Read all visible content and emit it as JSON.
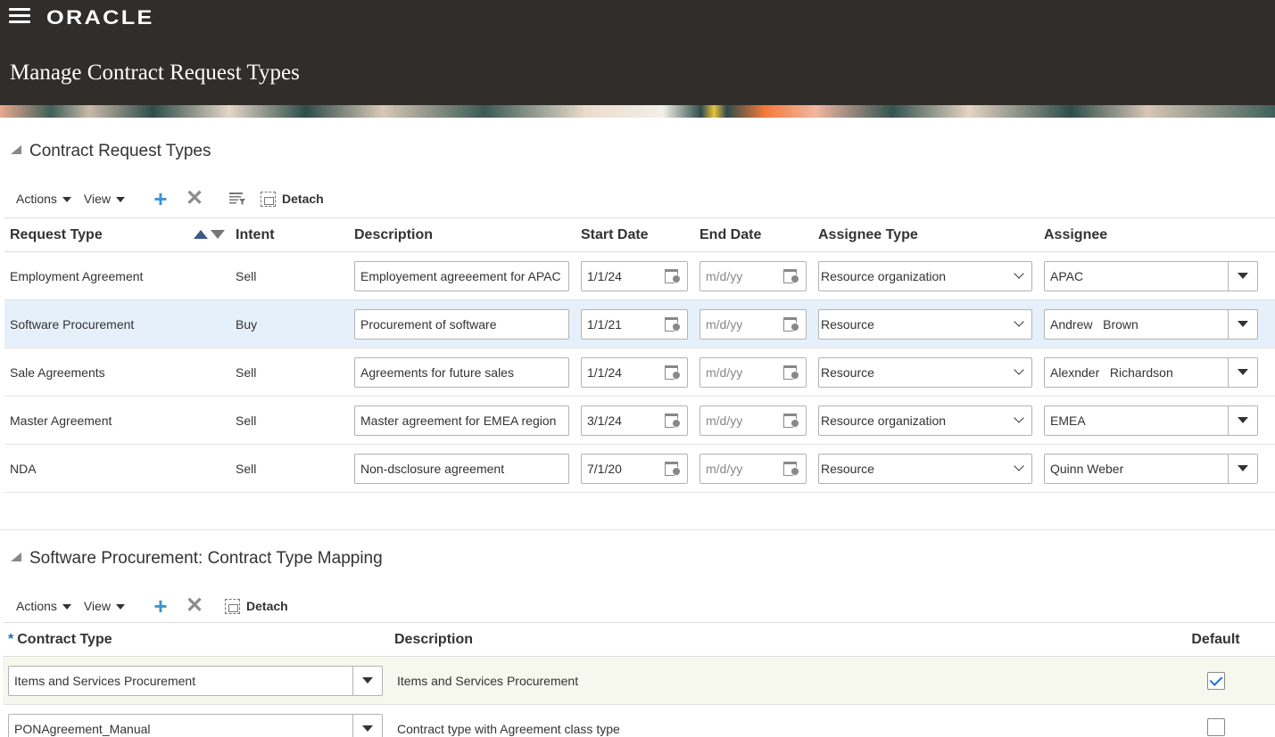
{
  "header": {
    "logo": "ORACLE",
    "title": "Manage Contract Request Types"
  },
  "section1": {
    "title": "Contract Request Types",
    "toolbar": {
      "actions": "Actions",
      "view": "View",
      "detach": "Detach"
    },
    "columns": [
      "Request Type",
      "Intent",
      "Description",
      "Start Date",
      "End Date",
      "Assignee Type",
      "Assignee"
    ],
    "rows": [
      {
        "request_type": "Employment Agreement",
        "intent": "Sell",
        "description": "Employement agreeement for APAC",
        "start_date": "1/1/24",
        "end_date": "m/d/yy",
        "assignee_type": "Resource organization",
        "assignee": "APAC"
      },
      {
        "request_type": "Software Procurement",
        "intent": "Buy",
        "description": "Procurement of software",
        "start_date": "1/1/21",
        "end_date": "m/d/yy",
        "assignee_type": "Resource",
        "assignee": "Andrew   Brown"
      },
      {
        "request_type": "Sale Agreements",
        "intent": "Sell",
        "description": "Agreements for future sales",
        "start_date": "1/1/24",
        "end_date": "m/d/yy",
        "assignee_type": "Resource",
        "assignee": "Alexnder   Richardson"
      },
      {
        "request_type": "Master Agreement",
        "intent": "Sell",
        "description": "Master agreement for EMEA region",
        "start_date": "3/1/24",
        "end_date": "m/d/yy",
        "assignee_type": "Resource organization",
        "assignee": "EMEA"
      },
      {
        "request_type": "NDA",
        "intent": "Sell",
        "description": "Non-dsclosure agreement",
        "start_date": "7/1/20",
        "end_date": "m/d/yy",
        "assignee_type": "Resource",
        "assignee": "Quinn Weber"
      }
    ]
  },
  "section2": {
    "title": "Software Procurement: Contract Type Mapping",
    "toolbar": {
      "actions": "Actions",
      "view": "View",
      "detach": "Detach"
    },
    "required_marker": "*",
    "columns": [
      "Contract Type",
      "Description",
      "Default"
    ],
    "rows": [
      {
        "contract_type": "Items and Services Procurement",
        "description": "Items and Services Procurement",
        "default": true
      },
      {
        "contract_type": "PONAgreement_Manual",
        "description": "Contract type with Agreement class type",
        "default": false
      }
    ]
  }
}
